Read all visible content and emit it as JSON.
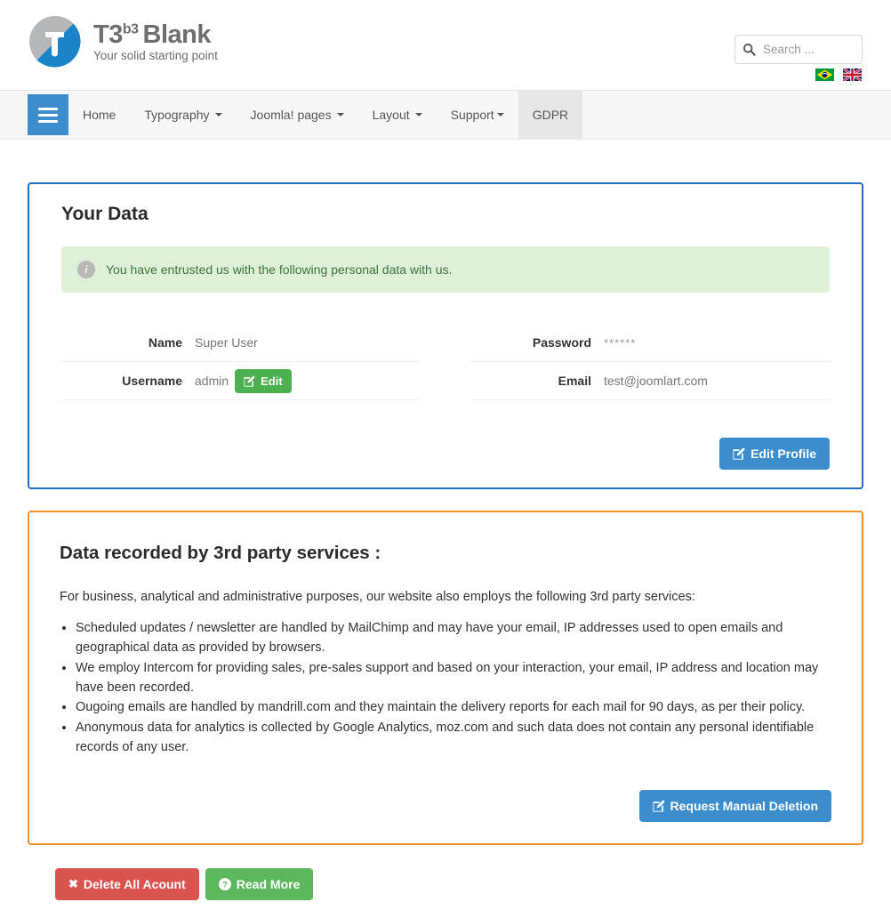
{
  "header": {
    "logo_title_main": "T3",
    "logo_title_sup": "b3",
    "logo_title_second": "Blank",
    "logo_tagline": "Your solid starting point",
    "search_placeholder": "Search ...",
    "search_value": "",
    "languages": [
      {
        "name": "brazil-flag",
        "label": "Português (Brasil)"
      },
      {
        "name": "uk-flag",
        "label": "English (UK)"
      }
    ]
  },
  "nav": {
    "toggle_label": "Menu",
    "items": [
      {
        "label": "Home",
        "caret": false,
        "active": false
      },
      {
        "label": "Typography",
        "caret": true,
        "active": false
      },
      {
        "label": "Joomla! pages",
        "caret": true,
        "active": false
      },
      {
        "label": "Layout",
        "caret": true,
        "active": false
      },
      {
        "label": "Support",
        "caret": true,
        "active": false
      },
      {
        "label": "GDPR",
        "caret": false,
        "active": true
      }
    ]
  },
  "your_data": {
    "title": "Your Data",
    "alert_text": "You have entrusted us with the following personal data with us.",
    "rows_left": [
      {
        "label": "Name",
        "value": "Super User",
        "button": null
      },
      {
        "label": "Username",
        "value": "admin",
        "button": "Edit"
      }
    ],
    "rows_right": [
      {
        "label": "Password",
        "value": "******",
        "button": null
      },
      {
        "label": "Email",
        "value": "test@joomlart.com",
        "button": null
      }
    ],
    "edit_profile_label": "Edit Profile"
  },
  "third_party": {
    "title": "Data recorded by 3rd party services :",
    "lead": "For business, analytical and administrative purposes, our website also employs the following 3rd party services:",
    "items": [
      "Scheduled updates / newsletter are handled by MailChimp and may have your email, IP addresses used to open emails and geographical data as provided by browsers.",
      "We employ Intercom for providing sales, pre-sales support and based on your interaction, your email, IP address and location may have been recorded.",
      "Ougoing emails are handled by mandrill.com and they maintain the delivery reports for each mail for 90 days, as per their policy.",
      "Anonymous data for analytics is collected by Google Analytics, moz.com and such data does not contain any personal identifiable records of any user."
    ],
    "request_deletion_label": "Request Manual Deletion"
  },
  "footer_actions": {
    "delete_label": "Delete All Acount",
    "read_more_label": "Read More"
  },
  "colors": {
    "primary_blue": "#3c8dcd",
    "panel_blue_border": "#1f6fc4",
    "panel_orange_border": "#f0932b",
    "success_green": "#4cb051",
    "danger_red": "#d9534f",
    "alert_bg": "#dff0d8",
    "alert_text": "#3c763d"
  }
}
